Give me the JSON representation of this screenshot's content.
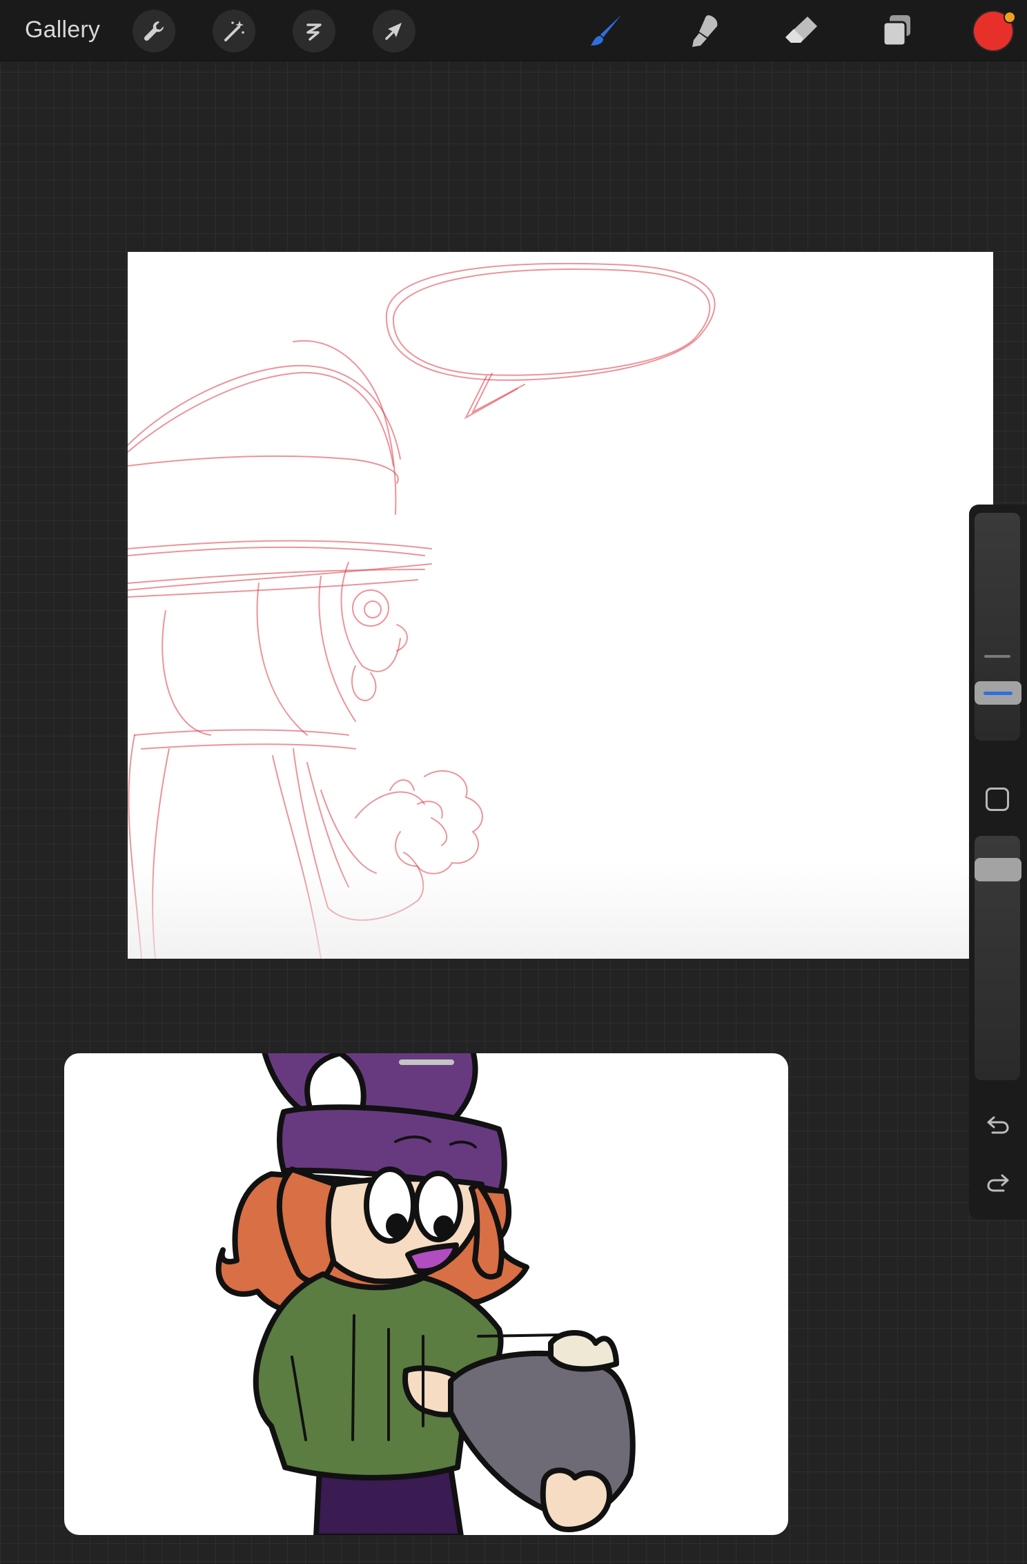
{
  "topbar": {
    "gallery_label": "Gallery",
    "left_tools": [
      {
        "icon": "wrench-icon"
      },
      {
        "icon": "magic-wand-icon"
      },
      {
        "icon": "selection-icon"
      },
      {
        "icon": "transform-arrow-icon"
      }
    ],
    "right_tools": [
      {
        "icon": "brush-icon",
        "active": true
      },
      {
        "icon": "smudge-icon"
      },
      {
        "icon": "eraser-icon"
      },
      {
        "icon": "layers-icon"
      }
    ],
    "current_color": "#e8302b",
    "accent_color": "#2f6fe0"
  },
  "sidebar": {
    "brush_size_slider": {
      "icon": "size-slider"
    },
    "modify_button": {
      "icon": "square-icon"
    },
    "opacity_slider": {
      "icon": "opacity-slider"
    },
    "undo": {
      "icon": "undo-icon"
    },
    "redo": {
      "icon": "redo-icon"
    }
  },
  "canvas": {
    "content": "sketch-image"
  },
  "reference_window": {
    "content": "reference-image"
  }
}
